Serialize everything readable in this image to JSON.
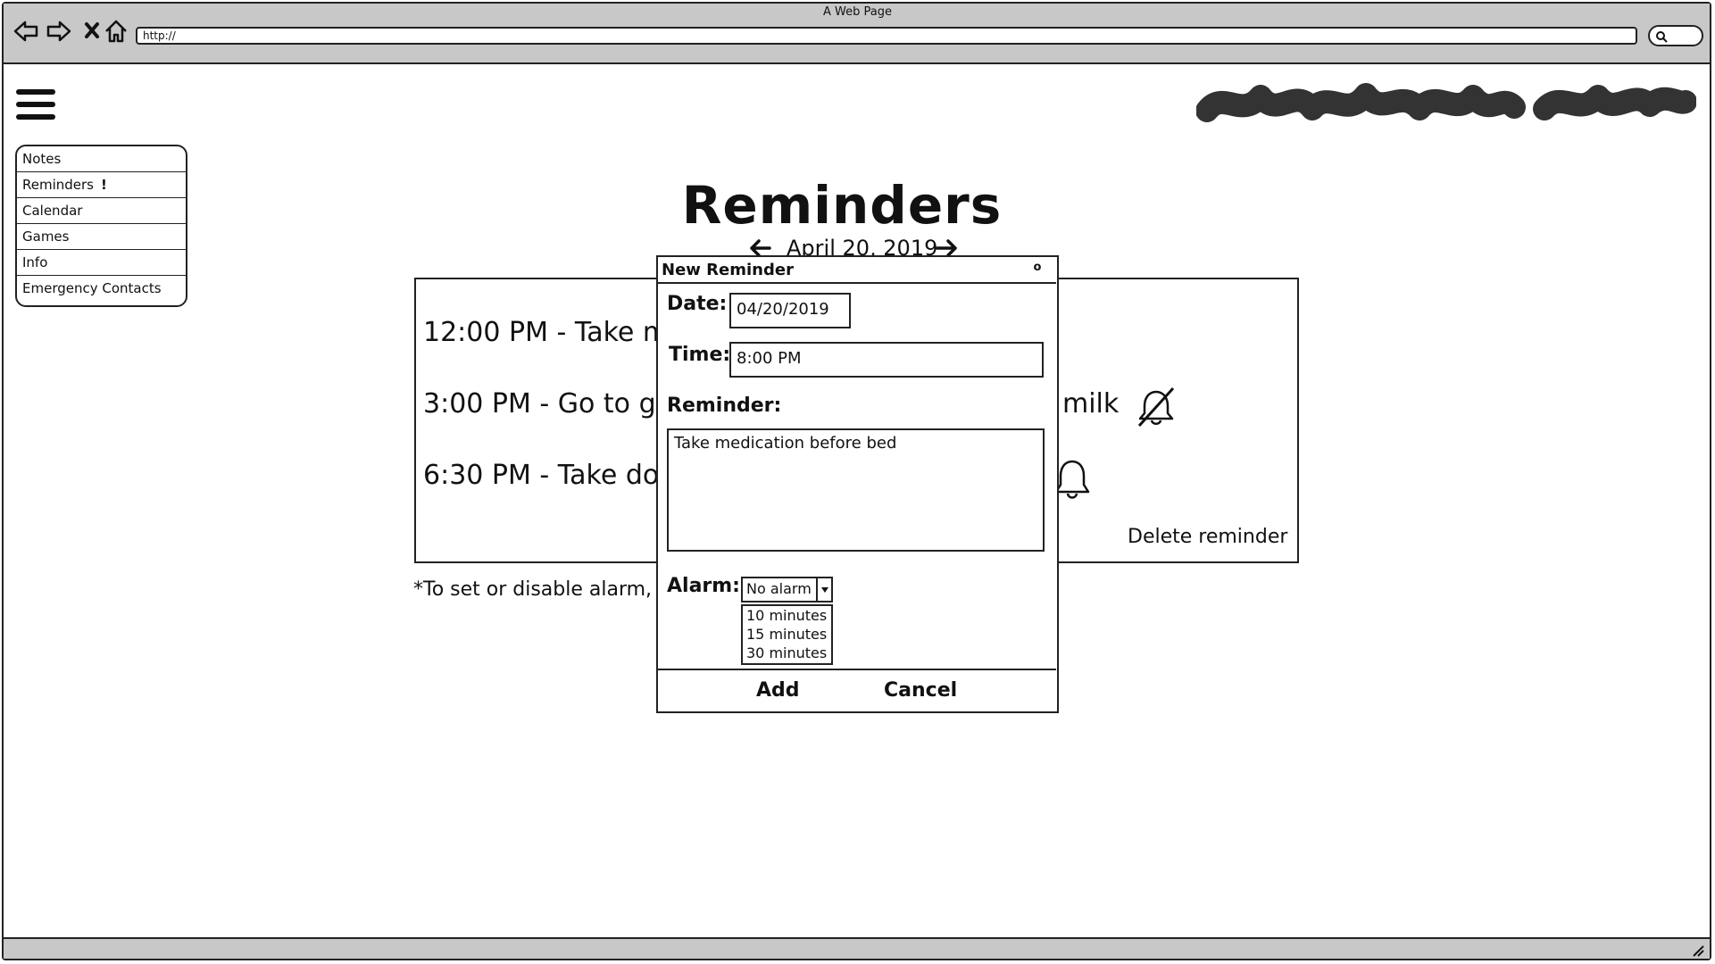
{
  "window": {
    "title": "A Web Page",
    "address": "http://"
  },
  "menu": {
    "items": [
      {
        "label": "Notes"
      },
      {
        "label": "Reminders",
        "alert": "!"
      },
      {
        "label": "Calendar"
      },
      {
        "label": "Games"
      },
      {
        "label": "Info"
      },
      {
        "label": "Emergency Contacts"
      }
    ]
  },
  "page": {
    "title": "Reminders",
    "date": "April 20, 2019",
    "reminders": [
      {
        "left_text": "12:00 PM - Take m"
      },
      {
        "left_text": "3:00 PM - Go to gr",
        "right_text": "milk",
        "alarm_icon": "bell-off-icon"
      },
      {
        "left_text": "6:30 PM - Take do",
        "alarm_icon": "bell-icon"
      }
    ],
    "delete_label": "Delete reminder",
    "footnote": "*To set or disable alarm,"
  },
  "modal": {
    "title": "New Reminder",
    "close_glyph": "o",
    "date_label": "Date:",
    "date_value": "04/20/2019",
    "time_label": "Time:",
    "time_value": "8:00 PM",
    "reminder_label": "Reminder:",
    "reminder_value": "Take medication before bed",
    "alarm_label": "Alarm:",
    "alarm_selected": "No alarm",
    "alarm_options": [
      "10 minutes",
      "15 minutes",
      "30 minutes"
    ],
    "add_label": "Add",
    "cancel_label": "Cancel"
  },
  "colors": {
    "chrome": "#c8c8c8",
    "ink": "#222222",
    "background": "#ffffff"
  }
}
